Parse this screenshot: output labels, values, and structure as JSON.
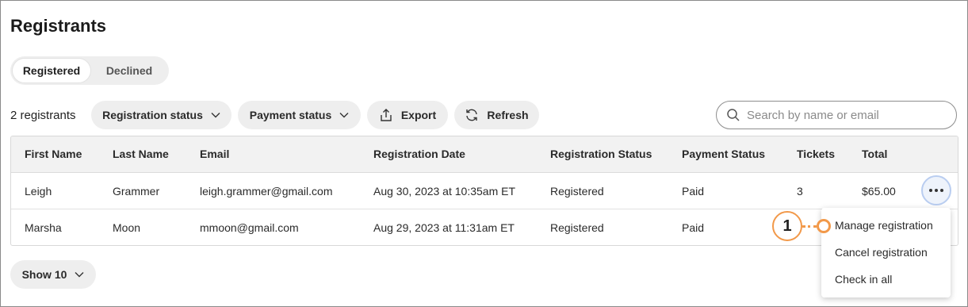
{
  "page": {
    "title": "Registrants"
  },
  "tabs": [
    {
      "label": "Registered",
      "active": true
    },
    {
      "label": "Declined",
      "active": false
    }
  ],
  "toolbar": {
    "count": "2 registrants",
    "registration_status": "Registration status",
    "payment_status": "Payment status",
    "export": "Export",
    "refresh": "Refresh",
    "search_placeholder": "Search by name or email"
  },
  "table": {
    "columns": [
      "First Name",
      "Last Name",
      "Email",
      "Registration Date",
      "Registration Status",
      "Payment Status",
      "Tickets",
      "Total"
    ],
    "rows": [
      {
        "first": "Leigh",
        "last": "Grammer",
        "email": "leigh.grammer@gmail.com",
        "date": "Aug 30, 2023 at 10:35am ET",
        "reg_status": "Registered",
        "pay_status": "Paid",
        "tickets": "3",
        "total": "$65.00"
      },
      {
        "first": "Marsha",
        "last": "Moon",
        "email": "mmoon@gmail.com",
        "date": "Aug 29, 2023 at 11:31am ET",
        "reg_status": "Registered",
        "pay_status": "Paid",
        "tickets": "",
        "total": ""
      }
    ]
  },
  "row_menu": {
    "items": [
      "Manage registration",
      "Cancel registration",
      "Check in all"
    ]
  },
  "callout": {
    "number": "1"
  },
  "pagination": {
    "show": "Show 10"
  },
  "colors": {
    "callout": "#f2994a",
    "pill_bg": "#eeeeee",
    "header_bg": "#f2f2f2"
  }
}
